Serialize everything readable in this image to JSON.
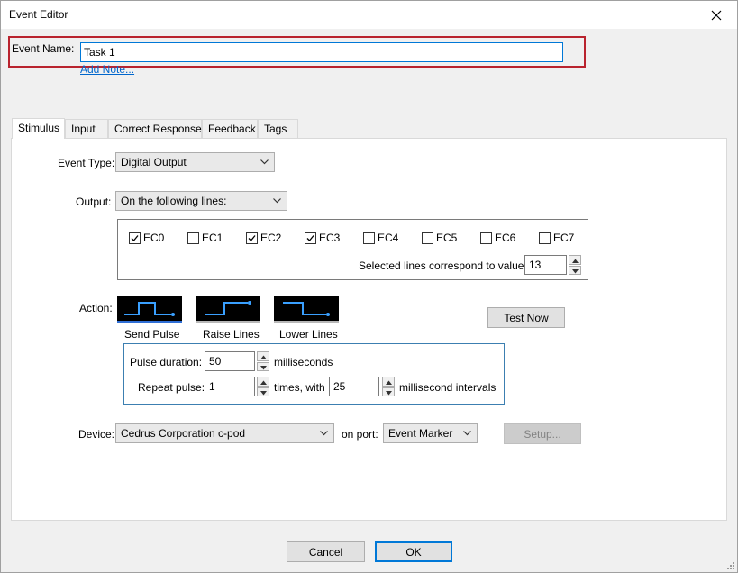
{
  "window": {
    "title": "Event Editor",
    "close_icon": "close-icon"
  },
  "event_name": {
    "label": "Event Name:",
    "value": "Task 1",
    "add_note": "Add Note..."
  },
  "tabs": [
    {
      "label": "Stimulus",
      "active": true
    },
    {
      "label": "Input",
      "active": false
    },
    {
      "label": "Correct Response",
      "active": false
    },
    {
      "label": "Feedback",
      "active": false
    },
    {
      "label": "Tags",
      "active": false
    }
  ],
  "stimulus": {
    "event_type_label": "Event Type:",
    "event_type_value": "Digital Output",
    "output_label": "Output:",
    "output_value": "On the following lines:",
    "lines": [
      {
        "label": "EC0",
        "checked": true
      },
      {
        "label": "EC1",
        "checked": false
      },
      {
        "label": "EC2",
        "checked": true
      },
      {
        "label": "EC3",
        "checked": true
      },
      {
        "label": "EC4",
        "checked": false
      },
      {
        "label": "EC5",
        "checked": false
      },
      {
        "label": "EC6",
        "checked": false
      },
      {
        "label": "EC7",
        "checked": false
      }
    ],
    "selected_lines_label": "Selected lines correspond to value",
    "selected_lines_value": "13",
    "action_label": "Action:",
    "actions": [
      {
        "label": "Send Pulse",
        "selected": true,
        "icon": "send-pulse-icon"
      },
      {
        "label": "Raise Lines",
        "selected": false,
        "icon": "raise-lines-icon"
      },
      {
        "label": "Lower Lines",
        "selected": false,
        "icon": "lower-lines-icon"
      }
    ],
    "test_now": "Test Now",
    "pulse_duration_label": "Pulse duration:",
    "pulse_duration_value": "50",
    "pulse_duration_unit": "milliseconds",
    "repeat_pulse_label": "Repeat pulse:",
    "repeat_pulse_value": "1",
    "repeat_times_label": "times, with",
    "interval_value": "25",
    "interval_unit": "millisecond intervals",
    "device_label": "Device:",
    "device_value": "Cedrus Corporation c-pod",
    "port_label": "on port:",
    "port_value": "Event Marker",
    "setup": "Setup..."
  },
  "footer": {
    "cancel": "Cancel",
    "ok": "OK"
  },
  "colors": {
    "accent": "#0078d7",
    "highlight_border": "#b9232e",
    "action_selected": "#2f6fd6",
    "action_unselected": "#b8b8b8",
    "waveform": "#3aa0ff"
  }
}
